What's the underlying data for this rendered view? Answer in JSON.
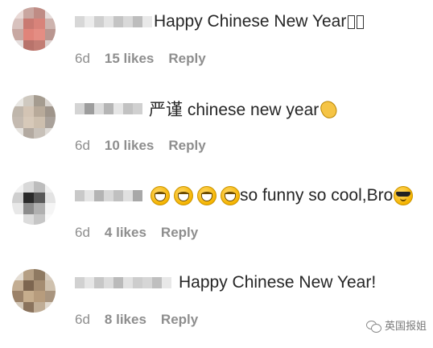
{
  "comments": [
    {
      "text": "Happy Chinese New Year",
      "time": "6d",
      "likes": "15 likes",
      "reply": "Reply",
      "trailing_glyphs": 2
    },
    {
      "text": "严谨 chinese new year",
      "time": "6d",
      "likes": "10 likes",
      "reply": "Reply",
      "emoji": "clapping-hands"
    },
    {
      "text": "so funny so cool,Bro",
      "time": "6d",
      "likes": "4 likes",
      "reply": "Reply",
      "leading_emoji": "laughing-face",
      "leading_emoji_count": 4,
      "trailing_emoji": "cool-face"
    },
    {
      "text": "Happy Chinese New Year!",
      "time": "6d",
      "likes": "8 likes",
      "reply": "Reply"
    }
  ],
  "watermark": {
    "label": "英国报姐",
    "icon": "wechat-icon"
  },
  "colors": {
    "text": "#262626",
    "meta": "#8e8e8e",
    "background": "#ffffff"
  }
}
